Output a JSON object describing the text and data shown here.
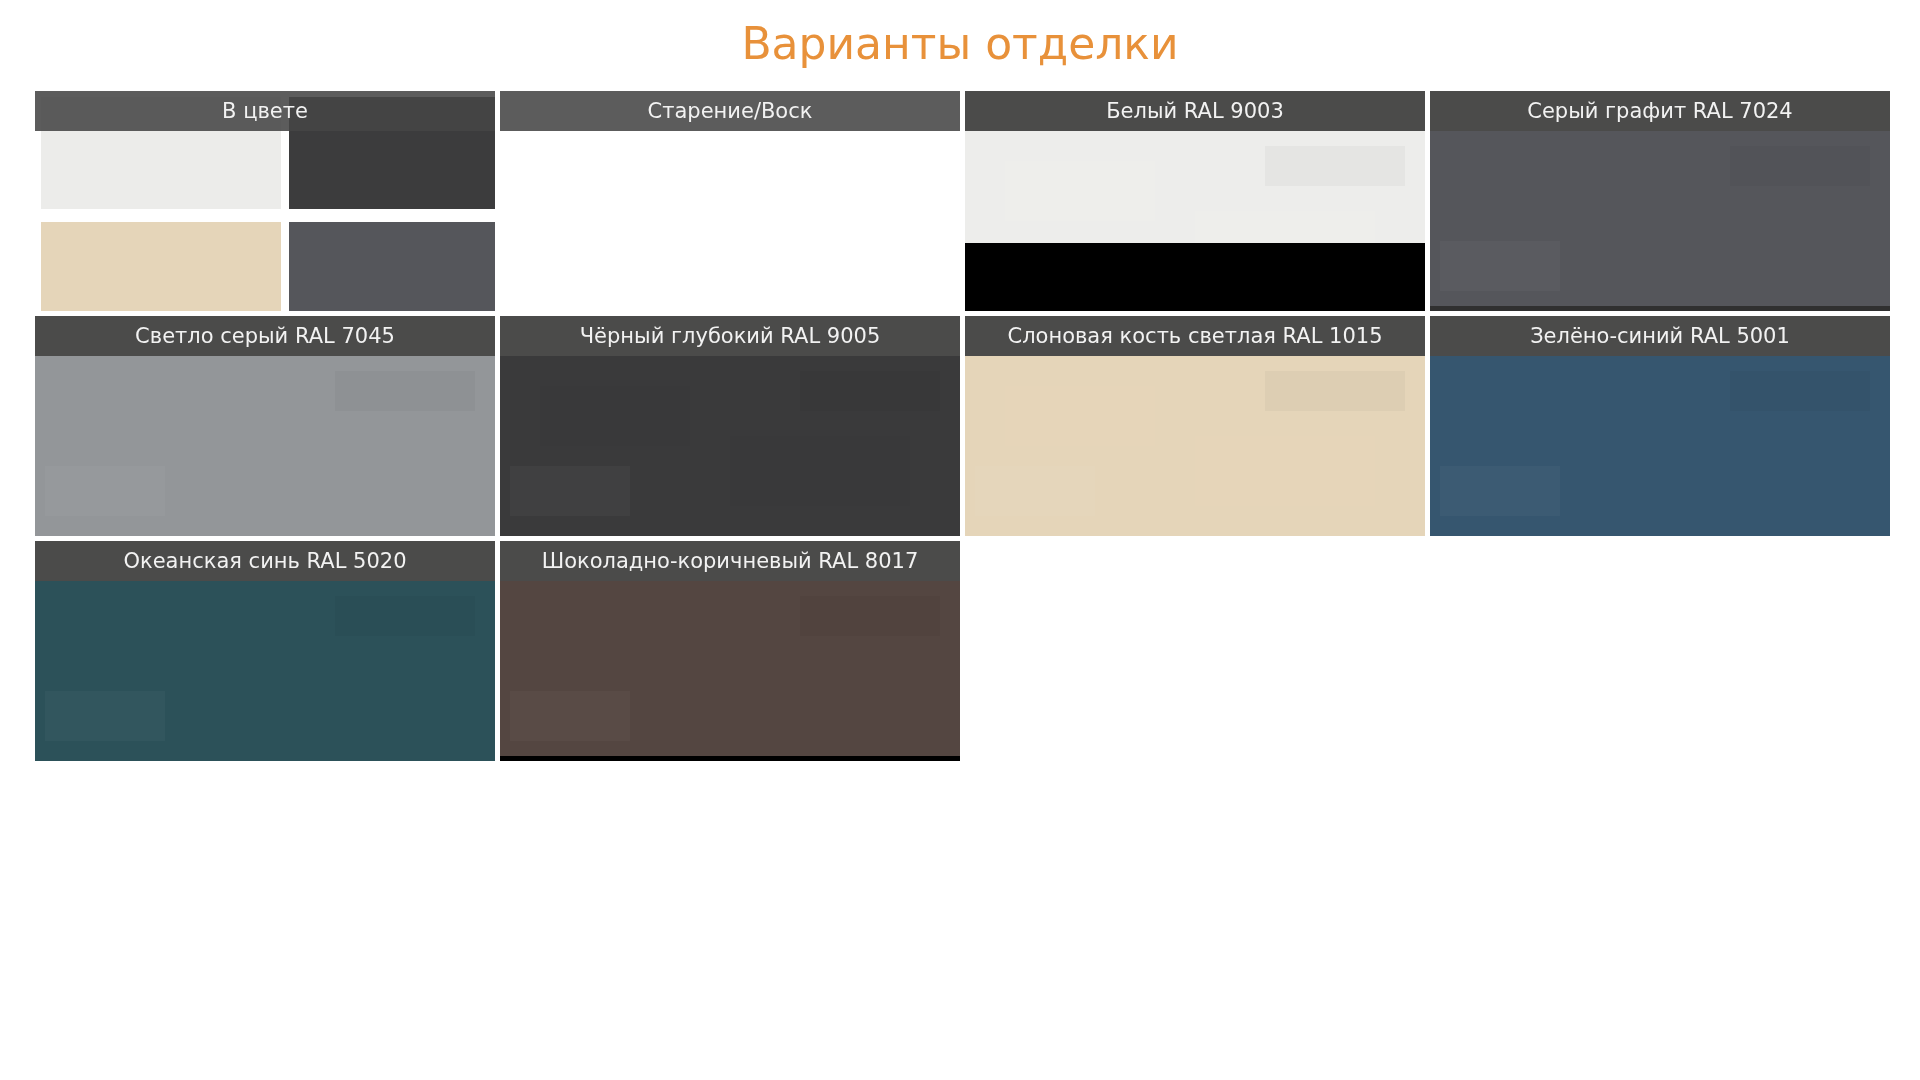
{
  "title": "Варианты отделки",
  "tiles": [
    {
      "kind": "picture",
      "caption": "В цвете"
    },
    {
      "kind": "blank",
      "caption": "Старение/Воск"
    },
    {
      "kind": "picture",
      "caption": "Белый RAL 9003"
    },
    {
      "kind": "picture",
      "caption": "Серый графит RAL 7024"
    },
    {
      "kind": "picture",
      "caption": "Светло серый RAL 7045"
    },
    {
      "kind": "picture",
      "caption": "Чёрный глубокий RAL 9005"
    },
    {
      "kind": "picture",
      "caption": "Слоновая кость светлая RAL 1015"
    },
    {
      "kind": "picture",
      "caption": "Зелёно-синий RAL 5001"
    },
    {
      "kind": "picture",
      "caption": "Океанская синь RAL 5020"
    },
    {
      "kind": "picture",
      "caption": "Шоколадно-коричневый RAL 8017"
    }
  ]
}
